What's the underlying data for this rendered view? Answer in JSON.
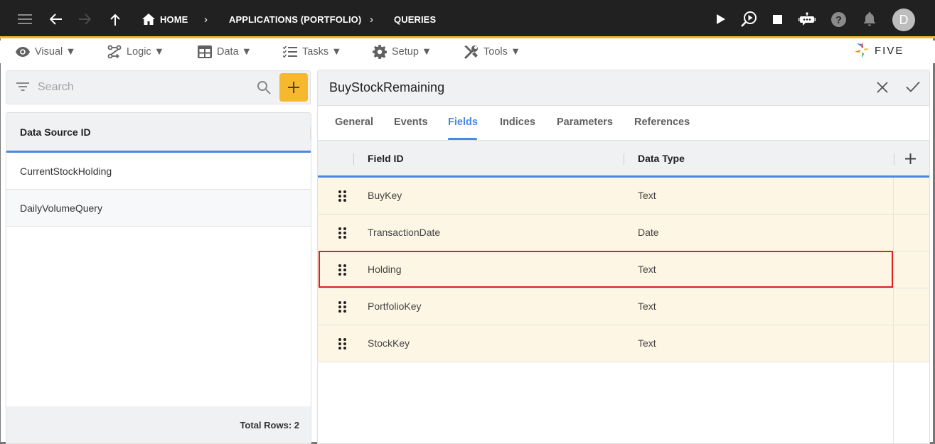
{
  "appbar": {
    "icons": {
      "menu": "hamburger-menu-icon",
      "back": "arrow-left-icon",
      "forward": "arrow-right-icon",
      "up": "arrow-up-icon",
      "home": "home-icon",
      "run": "play-icon",
      "debug": "debug-search-play-icon",
      "stop": "stop-icon",
      "assistant": "chat-bot-icon",
      "help": "help-circle-icon",
      "notifications": "bell-icon"
    },
    "breadcrumb": [
      {
        "label": "HOME"
      },
      {
        "label": "APPLICATIONS (PORTFOLIO)"
      },
      {
        "label": "QUERIES"
      }
    ],
    "avatar_initial": "D",
    "accent_color": "#f5b82e"
  },
  "menubar": {
    "items": [
      {
        "label": "Visual ▼",
        "icon": "eye-icon"
      },
      {
        "label": "Logic ▼",
        "icon": "flow-icon"
      },
      {
        "label": "Data ▼",
        "icon": "table-icon"
      },
      {
        "label": "Tasks ▼",
        "icon": "checklist-icon"
      },
      {
        "label": "Setup ▼",
        "icon": "gear-icon"
      },
      {
        "label": "Tools ▼",
        "icon": "tools-icon"
      }
    ],
    "logo_text": "FIVE"
  },
  "left_panel": {
    "search": {
      "placeholder": "Search",
      "value": ""
    },
    "add_label": "+",
    "column_header": "Data Source ID",
    "rows": [
      {
        "id": "CurrentStockHolding"
      },
      {
        "id": "DailyVolumeQuery"
      }
    ],
    "footer": "Total Rows: 2"
  },
  "detail": {
    "title": "BuyStockRemaining",
    "tabs": [
      {
        "label": "General",
        "active": false
      },
      {
        "label": "Events",
        "active": false
      },
      {
        "label": "Fields",
        "active": true
      },
      {
        "label": "Indices",
        "active": false
      },
      {
        "label": "Parameters",
        "active": false
      },
      {
        "label": "References",
        "active": false
      }
    ],
    "grid": {
      "columns": [
        "Field ID",
        "Data Type"
      ],
      "rows": [
        {
          "field_id": "BuyKey",
          "data_type": "Text",
          "selected": false
        },
        {
          "field_id": "TransactionDate",
          "data_type": "Date",
          "selected": false
        },
        {
          "field_id": "Holding",
          "data_type": "Text",
          "selected": true
        },
        {
          "field_id": "PortfolioKey",
          "data_type": "Text",
          "selected": false
        },
        {
          "field_id": "StockKey",
          "data_type": "Text",
          "selected": false
        }
      ],
      "row_color": "#fef6e4",
      "highlight_color": "#e02020"
    },
    "active_tab_color": "#4a89dc"
  }
}
